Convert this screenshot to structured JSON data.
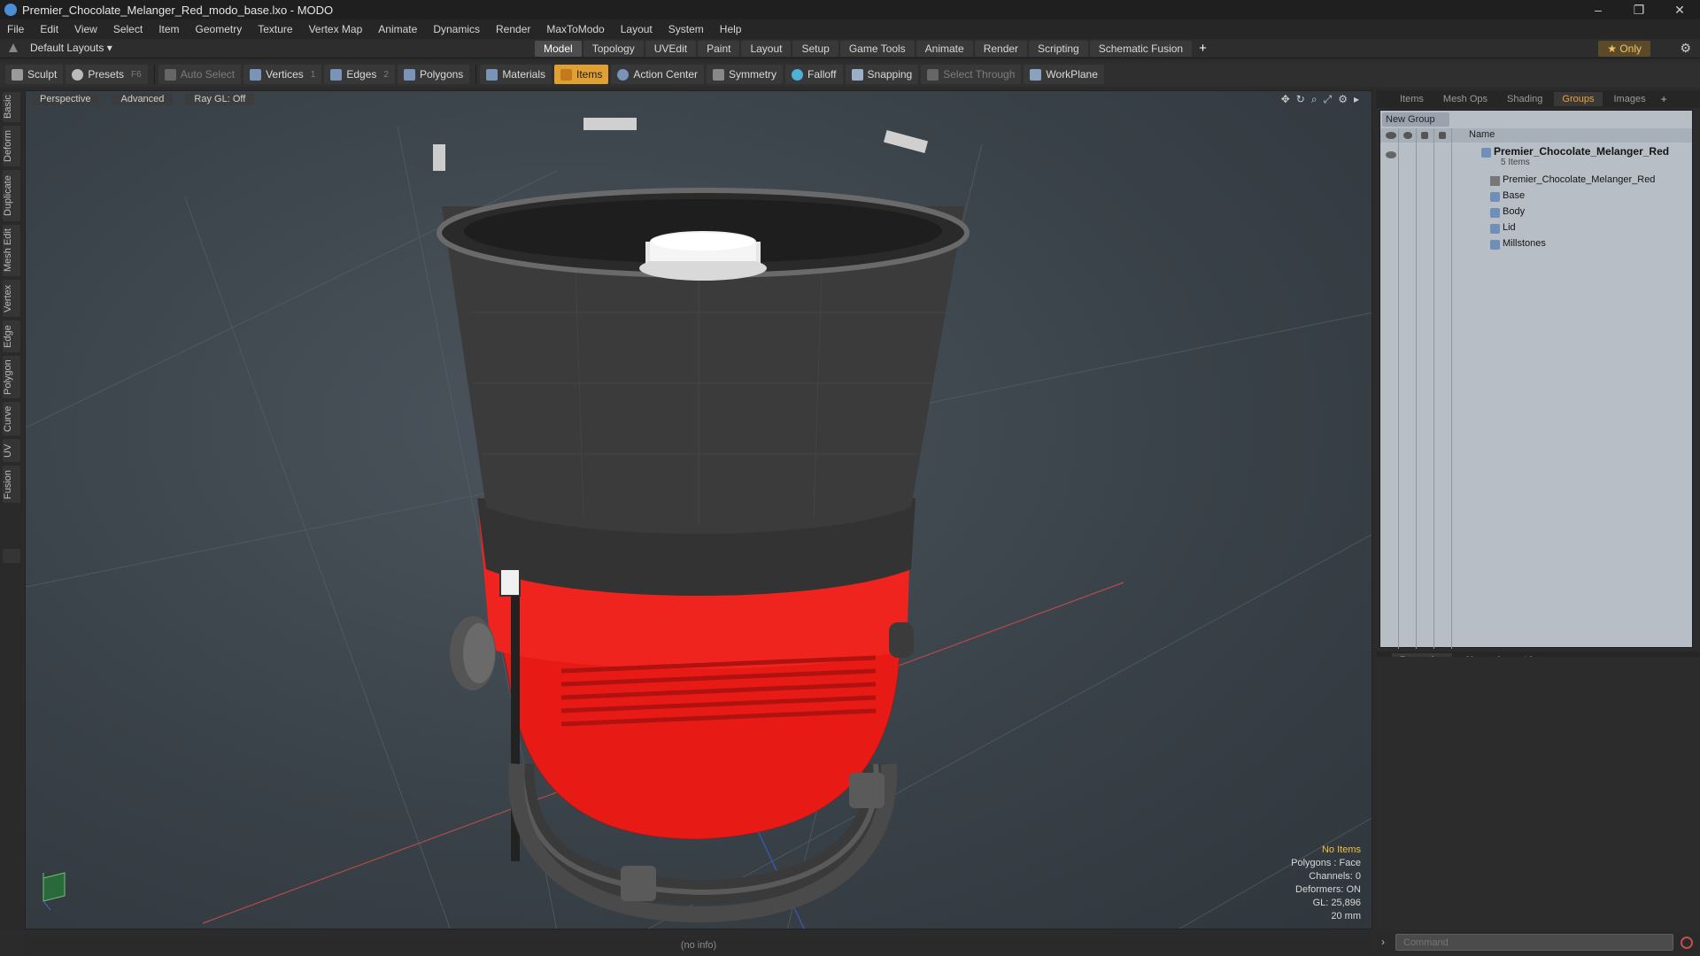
{
  "window": {
    "title": "Premier_Chocolate_Melanger_Red_modo_base.lxo - MODO",
    "minimize": "–",
    "restore": "❐",
    "close": "✕"
  },
  "menu": [
    "File",
    "Edit",
    "View",
    "Select",
    "Item",
    "Geometry",
    "Texture",
    "Vertex Map",
    "Animate",
    "Dynamics",
    "Render",
    "MaxToModo",
    "Layout",
    "System",
    "Help"
  ],
  "layoutbar": {
    "layout_name": "Default Layouts ▾",
    "tabs": [
      "Model",
      "Topology",
      "UVEdit",
      "Paint",
      "Layout",
      "Setup",
      "Game Tools",
      "Animate",
      "Render",
      "Scripting",
      "Schematic Fusion"
    ],
    "active_tab": "Model",
    "plus": "+",
    "only": "★ Only",
    "gear": "⚙"
  },
  "toolbar": {
    "sculpt": "Sculpt",
    "presets": "Presets",
    "presets_key": "F6",
    "auto_select": "Auto Select",
    "vertices": "Vertices",
    "vertices_key": "1",
    "edges": "Edges",
    "edges_key": "2",
    "polygons": "Polygons",
    "materials": "Materials",
    "items": "Items",
    "action_center": "Action Center",
    "symmetry": "Symmetry",
    "falloff": "Falloff",
    "snapping": "Snapping",
    "select_through": "Select Through",
    "workplane": "WorkPlane"
  },
  "left_tabs": [
    "Basic",
    "Deform",
    "Duplicate",
    "Mesh Edit",
    "Vertex",
    "Edge",
    "Polygon",
    "Curve",
    "UV",
    "Fusion"
  ],
  "viewport": {
    "view": "Perspective",
    "shading": "Advanced",
    "raygl": "Ray GL: Off",
    "info": {
      "selection": "No Items",
      "polygons": "Polygons : Face",
      "channels": "Channels: 0",
      "deformers": "Deformers: ON",
      "gl": "GL: 25,896",
      "size": "20 mm"
    },
    "colors": {
      "body_red": "#e81a16",
      "dark_shell": "#3b3b3b",
      "handle": "#4a4a4a",
      "lid_white": "#f2f2f2"
    }
  },
  "right_panel": {
    "tabs": [
      "Items",
      "Mesh Ops",
      "Shading",
      "Groups",
      "Images"
    ],
    "active_tab": "Groups",
    "new_group": "New Group",
    "name_header": "Name",
    "group": {
      "name": "Premier_Chocolate_Melanger_Red",
      "count": "5 Items"
    },
    "children": [
      "Premier_Chocolate_Melanger_Red",
      "Base",
      "Body",
      "Lid",
      "Millstones"
    ],
    "bottom_tabs": [
      "Properties",
      "Channels",
      "Lists"
    ],
    "bottom_active": "Properties",
    "command_placeholder": "Command"
  },
  "status": {
    "text": "(no info)"
  }
}
